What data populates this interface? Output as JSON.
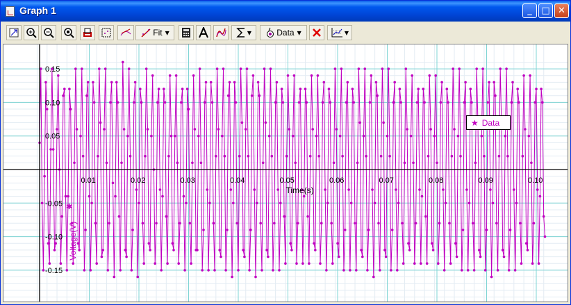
{
  "window": {
    "title": "Graph 1"
  },
  "titlebar_buttons": [
    {
      "name": "minimize-button",
      "glyph": "_"
    },
    {
      "name": "maximize-button",
      "glyph": "□"
    },
    {
      "name": "close-button",
      "glyph": "✕"
    }
  ],
  "toolbar": {
    "fit_label": "Fit",
    "data_label": "Data",
    "icons": [
      "autoscale-icon",
      "zoom-in-icon",
      "zoom-out-icon",
      "zoom-box-icon",
      "print-icon",
      "select-region-icon",
      "tangent-icon",
      "fit-icon",
      "calculator-icon",
      "text-annotation-icon",
      "function-icon",
      "sigma-icon",
      "data-icon",
      "delete-icon",
      "graph-options-icon"
    ]
  },
  "colors": {
    "series": "#c000c0",
    "grid": "#7fd4d4",
    "axis": "#000000",
    "titlebar": "#0054e3"
  },
  "chart_data": {
    "type": "scatter",
    "connected": true,
    "title": "",
    "xlabel": "Time(s)",
    "ylabel": "Voltage(V)",
    "xlim": [
      -0.0006,
      0.1035
    ],
    "ylim": [
      -0.19,
      0.165
    ],
    "xticks": [
      0.01,
      0.02,
      0.03,
      0.04,
      0.05,
      0.06,
      0.07,
      0.08,
      0.09,
      0.1
    ],
    "xtick_labels": [
      "0.01",
      "0.02",
      "0.03",
      "0.04",
      "0.05",
      "0.06",
      "0.07",
      "0.08",
      "0.09",
      "0.10"
    ],
    "yticks": [
      0.15,
      0.1,
      0.05,
      -0.05,
      -0.1,
      -0.15
    ],
    "ytick_labels": [
      "0.15",
      "0.10",
      "0.05",
      "-0.05",
      "-0.10",
      "-0.15"
    ],
    "grid": true,
    "legend": {
      "position": "top-right",
      "entries": [
        "Data"
      ]
    },
    "series": [
      {
        "name": "Data",
        "marker": "dot",
        "sample_interval": 0.00025,
        "x_start": 0.0,
        "y": [
          0.04,
          0.15,
          -0.05,
          -0.15,
          -0.01,
          0.13,
          0.09,
          -0.11,
          -0.14,
          0.03,
          0.15,
          0.03,
          -0.12,
          -0.11,
          0.06,
          0.14,
          0.0,
          -0.14,
          -0.07,
          0.11,
          0.12,
          -0.04,
          -0.15,
          -0.04,
          0.12,
          0.09,
          -0.08,
          -0.14,
          0.01,
          0.15,
          0.06,
          -0.11,
          -0.12,
          0.05,
          0.15,
          0.02,
          -0.15,
          -0.09,
          0.11,
          0.13,
          -0.04,
          -0.15,
          -0.05,
          0.13,
          0.1,
          -0.08,
          -0.14,
          0.02,
          0.15,
          0.07,
          -0.13,
          -0.12,
          0.06,
          0.15,
          0.01,
          -0.15,
          -0.08,
          0.1,
          0.13,
          -0.02,
          -0.16,
          -0.04,
          0.13,
          0.1,
          -0.07,
          -0.15,
          0.01,
          0.16,
          0.06,
          -0.12,
          -0.13,
          0.05,
          0.15,
          0.02,
          -0.15,
          -0.09,
          0.1,
          0.13,
          -0.03,
          -0.16,
          -0.05,
          0.12,
          0.1,
          -0.08,
          -0.14,
          0.02,
          0.15,
          0.06,
          -0.11,
          -0.12,
          0.05,
          0.14,
          0.0,
          -0.14,
          -0.08,
          0.1,
          0.12,
          -0.03,
          -0.15,
          -0.04,
          0.12,
          0.1,
          -0.07,
          -0.14,
          0.02,
          0.14,
          0.05,
          -0.11,
          -0.12,
          0.05,
          0.14,
          0.01,
          -0.14,
          -0.08,
          0.1,
          0.12,
          -0.04,
          -0.15,
          -0.05,
          0.12,
          0.09,
          -0.08,
          -0.14,
          0.01,
          0.14,
          0.06,
          -0.12,
          -0.12,
          0.05,
          0.15,
          0.01,
          -0.15,
          -0.09,
          0.1,
          0.13,
          -0.03,
          -0.15,
          -0.05,
          0.13,
          0.1,
          -0.08,
          -0.15,
          0.02,
          0.15,
          0.06,
          -0.12,
          -0.13,
          0.05,
          0.15,
          0.02,
          -0.15,
          -0.09,
          0.11,
          0.13,
          -0.03,
          -0.16,
          -0.05,
          0.13,
          0.1,
          -0.08,
          -0.15,
          0.02,
          0.15,
          0.07,
          -0.12,
          -0.13,
          0.06,
          0.15,
          0.02,
          -0.15,
          -0.09,
          0.11,
          0.14,
          -0.03,
          -0.16,
          -0.05,
          0.13,
          0.11,
          -0.08,
          -0.15,
          0.01,
          0.15,
          0.07,
          -0.12,
          -0.13,
          0.05,
          0.15,
          0.02,
          -0.15,
          -0.08,
          0.1,
          0.13,
          -0.03,
          -0.15,
          -0.05,
          0.12,
          0.1,
          -0.07,
          -0.14,
          0.02,
          0.14,
          0.06,
          -0.11,
          -0.12,
          0.05,
          0.14,
          0.01,
          -0.14,
          -0.08,
          0.1,
          0.12,
          -0.03,
          -0.14,
          -0.04,
          0.12,
          0.1,
          -0.07,
          -0.14,
          0.02,
          0.14,
          0.06,
          -0.11,
          -0.12,
          0.05,
          0.14,
          0.02,
          -0.14,
          -0.08,
          0.1,
          0.13,
          -0.03,
          -0.15,
          -0.05,
          0.12,
          0.1,
          -0.08,
          -0.14,
          0.01,
          0.15,
          0.06,
          -0.11,
          -0.13,
          0.05,
          0.15,
          0.02,
          -0.15,
          -0.09,
          0.1,
          0.13,
          -0.03,
          -0.15,
          -0.05,
          0.12,
          0.1,
          -0.08,
          -0.15,
          0.01,
          0.15,
          0.07,
          -0.12,
          -0.13,
          0.05,
          0.15,
          0.02,
          -0.15,
          -0.09,
          0.1,
          0.14,
          -0.03,
          -0.16,
          -0.05,
          0.13,
          0.11,
          -0.08,
          -0.15,
          0.02,
          0.15,
          0.07,
          -0.12,
          -0.13,
          0.05,
          0.15,
          0.02,
          -0.15,
          -0.09,
          0.1,
          0.13,
          -0.03,
          -0.15,
          -0.05,
          0.12,
          0.1,
          -0.08,
          -0.14,
          0.01,
          0.15,
          0.06,
          -0.11,
          -0.12,
          0.05,
          0.14,
          0.01,
          -0.14,
          -0.08,
          0.1,
          0.12,
          -0.03,
          -0.14,
          -0.04,
          0.12,
          0.1,
          -0.07,
          -0.14,
          0.02,
          0.14,
          0.06,
          -0.11,
          -0.12,
          0.05,
          0.14,
          0.01,
          -0.14,
          -0.08,
          0.1,
          0.13,
          -0.03,
          -0.15,
          -0.05,
          0.12,
          0.1,
          -0.08,
          -0.14,
          0.02,
          0.15,
          0.06,
          -0.11,
          -0.13,
          0.05,
          0.15,
          0.02,
          -0.15,
          -0.09,
          0.1,
          0.13,
          -0.03,
          -0.15,
          -0.05,
          0.12,
          0.1,
          -0.08,
          -0.15,
          0.01,
          0.15,
          0.07,
          -0.12,
          -0.13,
          0.05,
          0.15,
          0.02,
          -0.15,
          -0.09,
          0.1,
          0.13,
          -0.03,
          -0.16,
          -0.05,
          0.13,
          0.11,
          -0.08,
          -0.15,
          0.02,
          0.15,
          0.07,
          -0.12,
          -0.13,
          0.05,
          0.15,
          0.02,
          -0.15,
          -0.09,
          0.1,
          0.13,
          -0.03,
          -0.15,
          -0.05,
          0.12,
          0.1,
          -0.08,
          -0.14,
          0.02,
          0.14,
          0.06,
          -0.11,
          -0.12,
          0.05,
          0.14,
          0.01,
          -0.14,
          -0.08,
          0.1,
          0.12,
          -0.03,
          -0.14,
          -0.04,
          0.12,
          0.1,
          -0.07,
          -0.1
        ]
      }
    ]
  }
}
